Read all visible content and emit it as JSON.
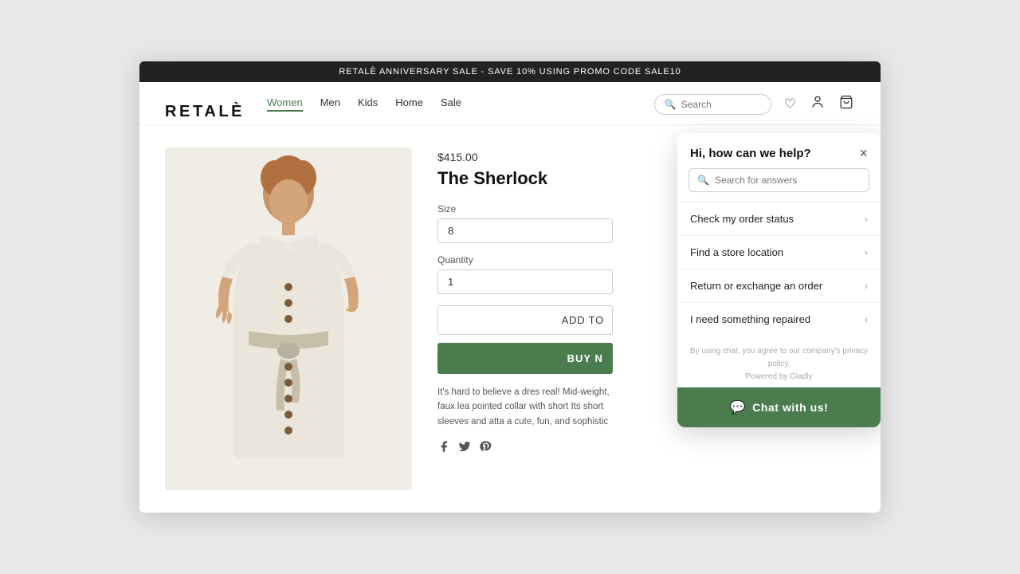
{
  "announcement": {
    "text": "RETALÈ ANNIVERSARY SALE - SAVE 10% USING PROMO CODE SALE10"
  },
  "header": {
    "logo": "RETALÈ",
    "nav": [
      {
        "label": "Women",
        "active": true
      },
      {
        "label": "Men",
        "active": false
      },
      {
        "label": "Kids",
        "active": false
      },
      {
        "label": "Home",
        "active": false
      },
      {
        "label": "Sale",
        "active": false
      }
    ],
    "search_placeholder": "Search"
  },
  "product": {
    "price": "$415.00",
    "title": "The Sherlock",
    "size_label": "Size",
    "size_value": "8",
    "quantity_label": "Quantity",
    "quantity_value": "1",
    "add_to_cart": "ADD TO",
    "buy_now": "BUY N",
    "description": "It's hard to believe a dres real! Mid-weight, faux lea pointed collar with short Its short sleeves and atta a cute, fun, and sophistic"
  },
  "chat": {
    "title": "Hi, how can we help?",
    "search_placeholder": "Search for answers",
    "options": [
      {
        "label": "Check my order status"
      },
      {
        "label": "Find a store location"
      },
      {
        "label": "Return or exchange an order"
      },
      {
        "label": "I need something repaired"
      }
    ],
    "privacy_text": "By using chat, you agree to our company's privacy policy.",
    "powered_text": "Powered by Gladly",
    "cta_label": "Chat with us!"
  },
  "icons": {
    "search": "🔍",
    "heart": "♡",
    "user": "👤",
    "cart": "🛒",
    "facebook": "f",
    "twitter": "t",
    "pinterest": "p",
    "close": "×",
    "chevron_right": "›",
    "chat_bubble": "💬"
  }
}
